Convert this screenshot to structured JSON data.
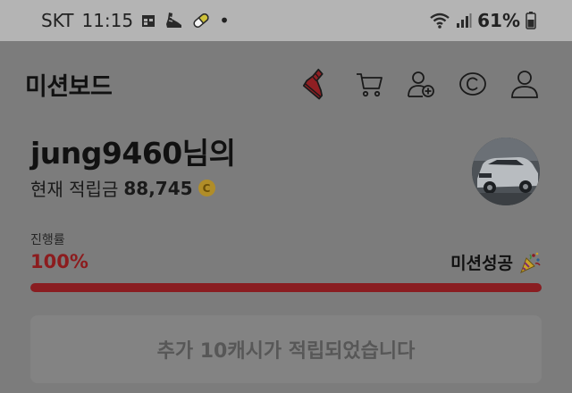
{
  "status_bar": {
    "carrier": "SKT",
    "time": "11:15",
    "dot": "•",
    "battery": "61%",
    "icons": [
      "calendar-icon",
      "sneaker-icon",
      "pill-icon",
      "wifi-icon",
      "signal-icon",
      "battery-icon"
    ]
  },
  "header": {
    "title": "미션보드",
    "icons": [
      "sneaker-icon",
      "cart-icon",
      "add-friend-icon",
      "copyright-coin-icon",
      "profile-icon"
    ]
  },
  "profile": {
    "username": "jung9460님의",
    "points_label": "현재 적립금",
    "points_value": "88,745",
    "coin_symbol": "C"
  },
  "progress": {
    "label": "진행률",
    "value_text": "100%",
    "value": 1.0,
    "status": "미션성공",
    "status_icon": "party-popper-icon"
  },
  "reward": {
    "message": "추가 10캐시가 적립되었습니다"
  },
  "colors": {
    "status_bar_bg": "#b4b4b4",
    "overlay_bg": "#7c7c7c",
    "accent_red": "#8a1d21",
    "coin_gold": "#b08d28"
  }
}
